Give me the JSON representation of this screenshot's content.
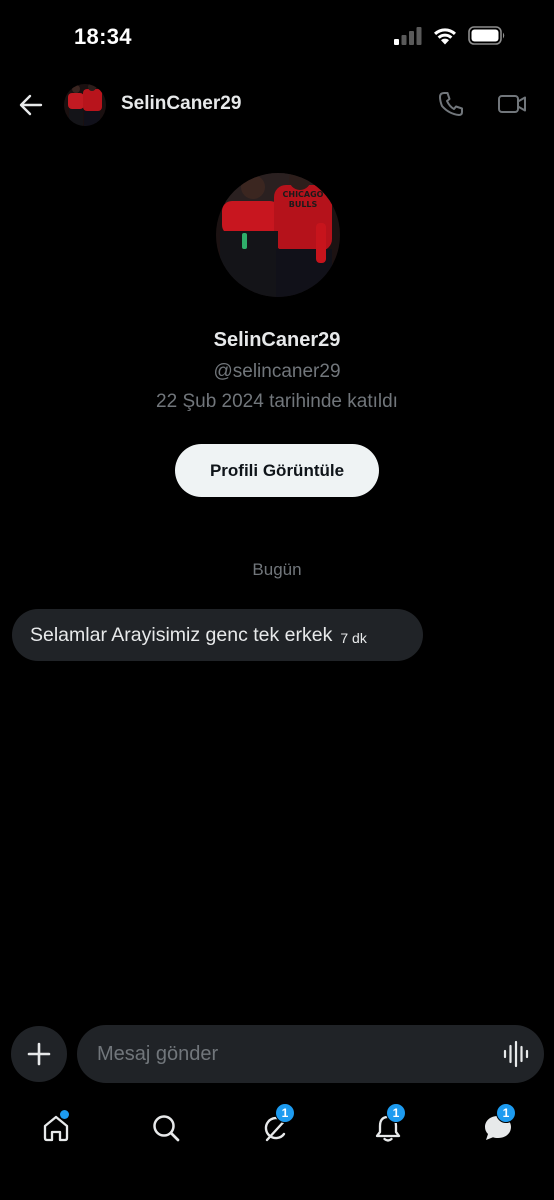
{
  "status_bar": {
    "time": "18:34",
    "icons": [
      "cellular-signal-icon",
      "wifi-icon",
      "battery-icon"
    ]
  },
  "header": {
    "name": "SelinCaner29",
    "icons": [
      "back-arrow-icon",
      "phone-icon",
      "video-camera-icon"
    ]
  },
  "profile": {
    "name": "SelinCaner29",
    "handle": "@selincaner29",
    "joined": "22 Şub 2024 tarihinde katıldı",
    "view_button": "Profili Görüntüle"
  },
  "conversation": {
    "date_label": "Bugün",
    "messages": [
      {
        "text": "Selamlar Arayisimiz genc tek erkek",
        "time": "7 dk"
      }
    ]
  },
  "composer": {
    "placeholder": "Mesaj gönder",
    "icons": [
      "plus-icon",
      "voice-wave-icon"
    ]
  },
  "nav": {
    "items": [
      {
        "name": "home",
        "icon": "home-icon",
        "dot": true
      },
      {
        "name": "search",
        "icon": "search-icon"
      },
      {
        "name": "grok",
        "icon": "grok-icon",
        "badge": "1"
      },
      {
        "name": "notifications",
        "icon": "bell-icon",
        "badge": "1"
      },
      {
        "name": "messages",
        "icon": "messages-icon",
        "badge": "1"
      }
    ]
  },
  "colors": {
    "background": "#000000",
    "bubble": "#202327",
    "accent": "#1d9bf0",
    "muted": "#71767b",
    "text": "#e7e9ea"
  }
}
